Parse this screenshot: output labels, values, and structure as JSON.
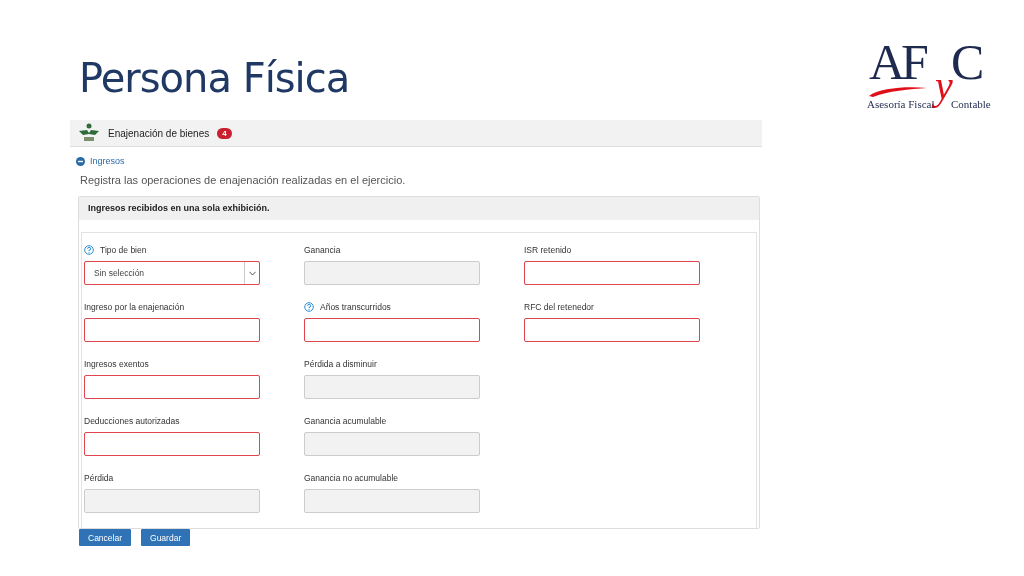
{
  "slide": {
    "title": "Persona Física"
  },
  "logo": {
    "mark_left": "AF",
    "mark_middle": "y",
    "mark_right": "C",
    "tagline_left": "Asesoría Fiscal",
    "tagline_right": "Contable"
  },
  "header": {
    "title": "Enajenación de bienes",
    "badge": "4"
  },
  "section": {
    "label": "Ingresos",
    "expanded": true
  },
  "description": "Registra las operaciones de enajenación realizadas en el ejercicio.",
  "panel": {
    "title": "Ingresos recibidos en una sola exhibición."
  },
  "columns": [
    [
      {
        "label": "Tipo de bien",
        "help": true,
        "kind": "select",
        "value": "Sin selección",
        "required": true,
        "disabled": false
      },
      {
        "label": "Ingreso por la enajenación",
        "help": false,
        "kind": "input",
        "required": true,
        "disabled": false
      },
      {
        "label": "Ingresos exentos",
        "help": false,
        "kind": "input",
        "required": true,
        "disabled": false
      },
      {
        "label": "Deducciones autorizadas",
        "help": false,
        "kind": "input",
        "required": true,
        "disabled": false
      },
      {
        "label": "Pérdida",
        "help": false,
        "kind": "input",
        "required": false,
        "disabled": true
      }
    ],
    [
      {
        "label": "Ganancia",
        "help": false,
        "kind": "input",
        "required": false,
        "disabled": true
      },
      {
        "label": "Años transcurridos",
        "help": true,
        "kind": "input",
        "required": true,
        "disabled": false
      },
      {
        "label": "Pérdida a disminuir",
        "help": false,
        "kind": "input",
        "required": false,
        "disabled": true
      },
      {
        "label": "Ganancia acumulable",
        "help": false,
        "kind": "input",
        "required": false,
        "disabled": true
      },
      {
        "label": "Ganancia no acumulable",
        "help": false,
        "kind": "input",
        "required": false,
        "disabled": true
      }
    ],
    [
      {
        "label": "ISR retenido",
        "help": false,
        "kind": "input",
        "required": true,
        "disabled": false
      },
      {
        "label": "RFC del retenedor",
        "help": false,
        "kind": "input",
        "required": true,
        "disabled": false
      }
    ]
  ],
  "buttons": [
    {
      "label": "Cancelar"
    },
    {
      "label": "Guardar"
    }
  ]
}
